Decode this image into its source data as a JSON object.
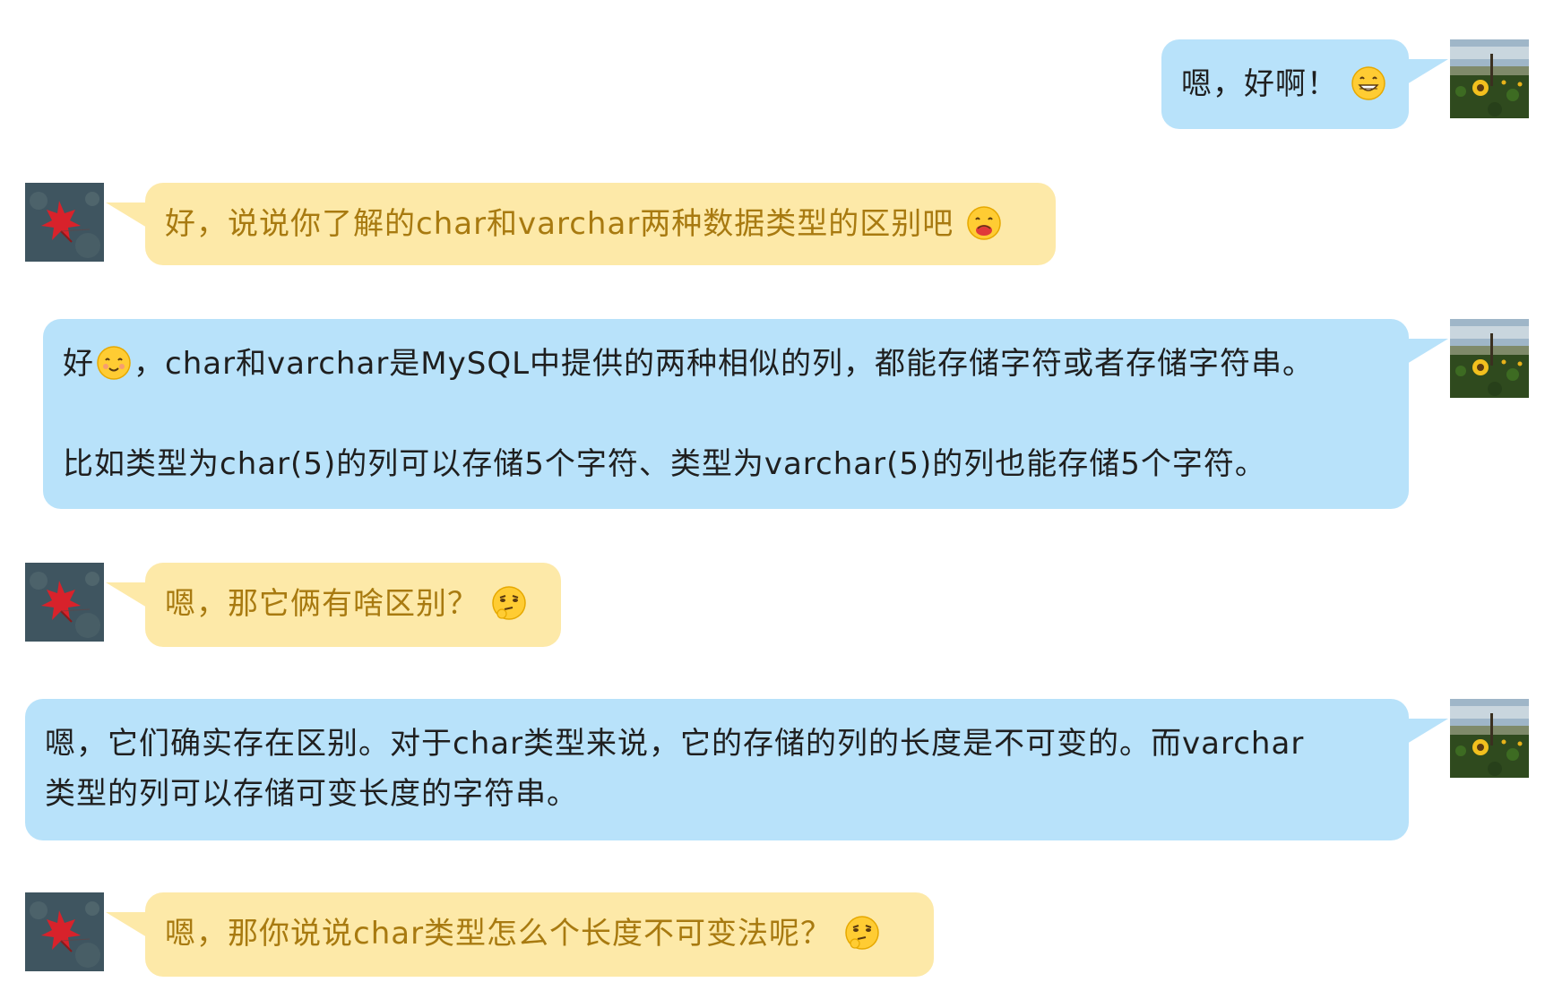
{
  "messages": [
    {
      "sender": "self",
      "text": "嗯，好啊！",
      "emoji": "grinning-face"
    },
    {
      "sender": "other",
      "text": "好，说说你了解的char和varchar两种数据类型的区别吧",
      "emoji": "savoring-food-face"
    },
    {
      "sender": "self",
      "line1_a": "好",
      "emoji": "smiling-face",
      "line1_b": "，char和varchar是MySQL中提供的两种相似的列，都能存储字符或者存储字符串。",
      "line2": "比如类型为char(5)的列可以存储5个字符、类型为varchar(5)的列也能存储5个字符。"
    },
    {
      "sender": "other",
      "text": "嗯，那它俩有啥区别？",
      "emoji": "thinking-face"
    },
    {
      "sender": "self",
      "line1": "嗯，它们确实存在区别。对于char类型来说，它的存储的列的长度是不可变的。而varchar",
      "line2": "类型的列可以存储可变长度的字符串。"
    },
    {
      "sender": "other",
      "text": "嗯，那你说说char类型怎么个长度不可变法呢？",
      "emoji": "thinking-face"
    }
  ],
  "colors": {
    "self_bubble": "#b8e2fa",
    "other_bubble": "#fde9a8",
    "other_text": "#a87a10",
    "self_text": "#1f1f1f"
  },
  "avatars": {
    "self": "sunflower-field-avatar",
    "other": "red-maple-leaf-avatar"
  }
}
